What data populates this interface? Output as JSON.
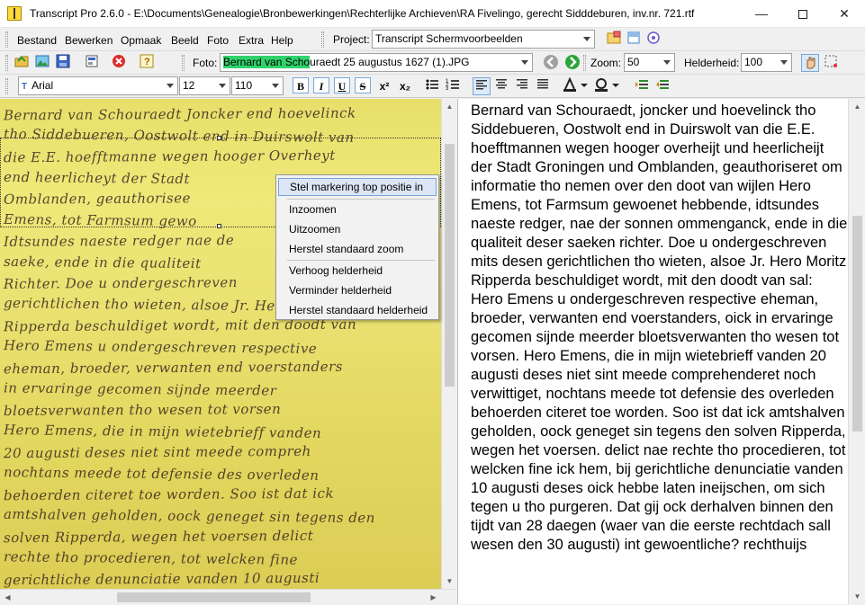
{
  "window": {
    "title": "Transcript Pro 2.6.0 - E:\\Documents\\Genealogie\\Bronbewerkingen\\Rechterlijke Archieven\\RA Fivelingo, gerecht Sidddeburen, inv.nr. 721.rtf",
    "minimize_glyph": "—",
    "close_glyph": "✕"
  },
  "menu": [
    {
      "label": "Bestand"
    },
    {
      "label": "Bewerken"
    },
    {
      "label": "Opmaak"
    },
    {
      "label": "Beeld"
    },
    {
      "label": "Foto"
    },
    {
      "label": "Extra"
    },
    {
      "label": "Help"
    }
  ],
  "project": {
    "label": "Project:",
    "value": "Transcript Schermvoorbeelden"
  },
  "photo": {
    "label": "Foto:",
    "value_highlight": "Bernard van Scho",
    "value_rest": "uraedt 25 augustus 1627 (1).JPG"
  },
  "zoom": {
    "label": "Zoom:",
    "value": "50"
  },
  "brightness": {
    "label": "Helderheid:",
    "value": "100"
  },
  "font": {
    "family": "Arial",
    "size": "12",
    "zoom": "110"
  },
  "format_buttons": {
    "bold": "B",
    "italic": "I",
    "underline": "U",
    "strike": "S",
    "superscript": "x²",
    "subscript": "x₂"
  },
  "context_menu": [
    {
      "label": "Stel markering top positie in",
      "selected": true
    },
    {
      "label": "Inzoomen"
    },
    {
      "label": "Uitzoomen"
    },
    {
      "label": "Herstel standaard zoom"
    },
    {
      "label": "Verhoog helderheid"
    },
    {
      "label": "Verminder helderheid"
    },
    {
      "label": "Herstel standaard helderheid"
    }
  ],
  "manuscript_lines": [
    "Bernard van Schouraedt Joncker end hoevelinck",
    "tho Siddebueren, Oostwolt end in Duirswolt van",
    "die E.E. hoefftmanne wegen hooger Overheyt",
    "end heerlicheyt der Stadt",
    "Omblanden, geauthorisee",
    "Emens, tot Farmsum gewo",
    "Idtsundes naeste redger nae de",
    "saeke, ende in die qualiteit",
    "Richter. Doe u ondergeschreven",
    "gerichtlichen tho wieten, alsoe Jr. Hero Moritz",
    "Ripperda beschuldiget wordt, mit den doodt van",
    "Hero Emens u ondergeschreven respective",
    "eheman, broeder, verwanten end voerstanders",
    "in ervaringe gecomen sijnde meerder",
    "bloetsverwanten tho wesen tot vorsen",
    "Hero Emens, die in mijn wietebrieff vanden",
    "20 augusti deses niet sint meede compreh",
    "nochtans meede tot defensie des overleden",
    "behoerden citeret toe worden. Soo ist dat ick",
    "amtshalven geholden, oock geneget sin tegens den",
    "solven Ripperda, wegen het voersen delict",
    "rechte tho procedieren, tot welcken fine",
    "gerichtliche denunciatie vanden 10 augusti"
  ],
  "transcript_text": "Bernard van Schouraedt, joncker und hoevelinck tho Siddebueren, Oostwolt end in Duirswolt van die E.E. hoefftmannen wegen hooger overheijt und heerlicheijt der Stadt Groningen und Omblanden, geauthoriseret om informatie tho nemen over den doot van wijlen Hero Emens, tot Farmsum gewoenet hebbende, idtsundes naeste redger, nae der sonnen ommenganck, ende in die qualiteit deser saeken richter. Doe u ondergeschreven mits desen gerichtlichen tho wieten, alsoe Jr. Hero Moritz Ripperda beschuldiget wordt, mit den doodt van sal: Hero Emens u ondergeschreven respective eheman, broeder, verwanten end voerstanders, oick in ervaringe gecomen sijnde meerder bloetsverwanten tho wesen tot vorsen. Hero Emens, die in mijn wietebrieff vanden 20 augusti deses niet sint meede comprehenderet noch verwittiget, nochtans meede tot defensie des overleden behoerden citeret toe worden. Soo ist dat ick amtshalven geholden, oock geneget sin tegens den solven Ripperda, wegen het voersen. delict nae rechte tho procedieren, tot welcken fine ick hem, bij gerichtliche denunciatie vanden 10 augusti deses oick hebbe laten ineijschen, om sich tegen u tho purgeren. Dat gij ock derhalven binnen den tijdt van 28 daegen (waer van die eerste rechtdach sall wesen den 30 augusti) int gewoentliche? rechthuijs"
}
